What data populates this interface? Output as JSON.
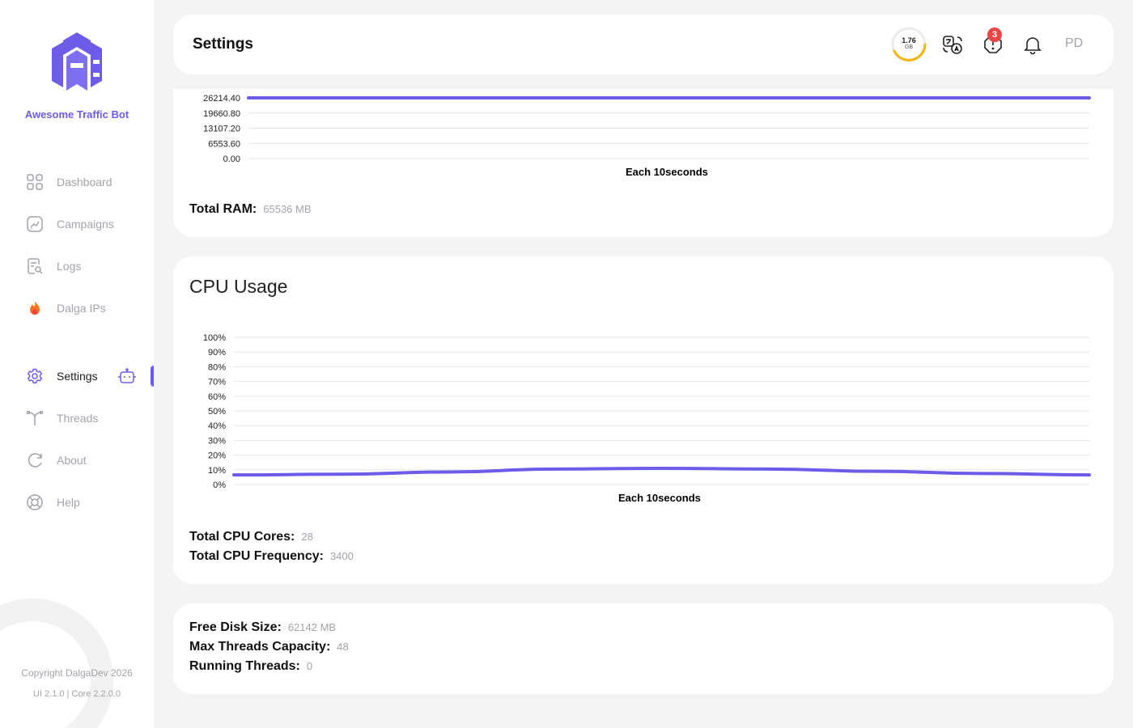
{
  "app": {
    "brand": "Awesome Traffic Bot",
    "copyright": "Copyright DalgaDev 2026",
    "version": "UI 2.1.0 | Core 2.2.0.0",
    "accent": "#6c5ce7"
  },
  "sidebar": {
    "items": [
      {
        "label": "Dashboard",
        "icon": "grid-icon"
      },
      {
        "label": "Campaigns",
        "icon": "chart-icon"
      },
      {
        "label": "Logs",
        "icon": "log-search-icon"
      },
      {
        "label": "Dalga IPs",
        "icon": "flame-icon"
      },
      {
        "label": "Settings",
        "icon": "gear-icon",
        "active": true
      },
      {
        "label": "Threads",
        "icon": "threads-icon"
      },
      {
        "label": "About",
        "icon": "refresh-icon"
      },
      {
        "label": "Help",
        "icon": "lifebuoy-icon"
      }
    ]
  },
  "header": {
    "title": "Settings",
    "ram_usage": "1.76",
    "ram_unit": "GB",
    "alerts_count": "3",
    "avatar_initials": "PD"
  },
  "ram": {
    "total_label": "Total RAM:",
    "total_value": "65536 MB"
  },
  "cpu": {
    "title": "CPU Usage",
    "cores_label": "Total CPU Cores:",
    "cores_value": "28",
    "freq_label": "Total CPU Frequency:",
    "freq_value": "3400"
  },
  "system": {
    "disk_label": "Free Disk Size:",
    "disk_value": "62142 MB",
    "threads_cap_label": "Max Threads Capacity:",
    "threads_cap_value": "48",
    "running_label": "Running Threads:",
    "running_value": "0"
  },
  "chart_data": [
    {
      "type": "line",
      "title": "",
      "xlabel": "Each 10seconds",
      "ylabel": "",
      "yticks": [
        "26214.40",
        "19660.80",
        "13107.20",
        "6553.60",
        "0.00"
      ],
      "ylim": [
        0,
        26214.4
      ],
      "series": [
        {
          "values": [
            26214.4,
            26214.4,
            26214.4,
            26214.4,
            26214.4,
            26214.4,
            26214.4
          ]
        }
      ],
      "color": "#6c5ce7"
    },
    {
      "type": "line",
      "title": "",
      "xlabel": "Each 10seconds",
      "ylabel": "",
      "yticks": [
        "100%",
        "90%",
        "80%",
        "70%",
        "60%",
        "50%",
        "40%",
        "30%",
        "20%",
        "10%",
        "0%"
      ],
      "ylim": [
        0,
        100
      ],
      "series": [
        {
          "values": [
            6.5,
            7,
            8.5,
            10.5,
            11,
            10.5,
            9,
            7.5,
            6.5
          ]
        }
      ],
      "color": "#6c5ce7"
    }
  ]
}
